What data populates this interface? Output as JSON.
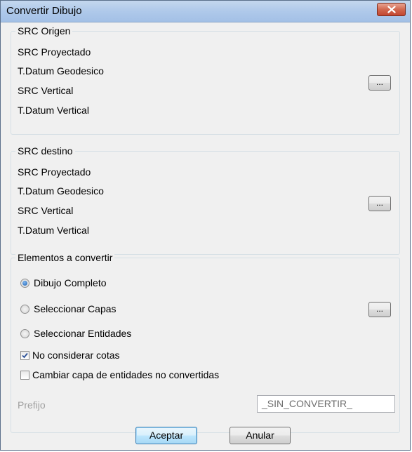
{
  "window": {
    "title": "Convertir Dibujo"
  },
  "src_origen": {
    "title": "SRC Origen",
    "labels": [
      "SRC Proyectado",
      "T.Datum Geodesico",
      "SRC Vertical",
      "T.Datum Vertical"
    ],
    "button_label": "..."
  },
  "src_destino": {
    "title": "SRC destino",
    "labels": [
      "SRC Proyectado",
      "T.Datum Geodesico",
      "SRC Vertical",
      "T.Datum Vertical"
    ],
    "button_label": "..."
  },
  "elementos": {
    "title": "Elementos a convertir",
    "options": [
      {
        "label": "Dibujo Completo",
        "checked": true
      },
      {
        "label": "Seleccionar Capas",
        "checked": false
      },
      {
        "label": "Seleccionar Entidades",
        "checked": false
      }
    ],
    "capas_button_label": "...",
    "no_considerar_cotas": {
      "label": "No considerar cotas",
      "checked": true
    },
    "cambiar_capa": {
      "label": "Cambiar capa de entidades no convertidas",
      "checked": false
    },
    "prefijo_label": "Prefijo",
    "prefijo_value": "_SIN_CONVERTIR_"
  },
  "buttons": {
    "accept": "Aceptar",
    "cancel": "Anular"
  }
}
